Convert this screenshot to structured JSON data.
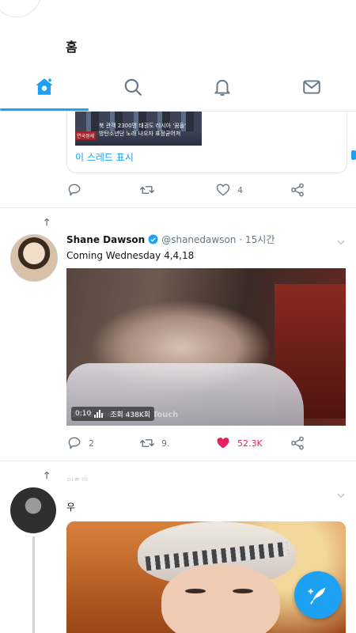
{
  "header": {
    "title": "홈"
  },
  "tabs": [
    "home",
    "search",
    "notifications",
    "messages"
  ],
  "quoted": {
    "thumb_caption_1": "북 관객 2300명 태권도 러시아 '꿈돌'",
    "thumb_caption_2": "방탄소년단 노래 나오자 표정굳어져",
    "thumb_channel": "연국정세",
    "show_thread": "이 스레드 표시"
  },
  "tweet0_actions": {
    "reply": "",
    "retweet": "",
    "like": "4"
  },
  "tweet1": {
    "name": "Shane Dawson",
    "handle": "@shanedawson",
    "time": "· 15시간",
    "text": "Coming Wednesday 4,4,18",
    "video": {
      "duration": "0:10",
      "views": "조회 438K회",
      "watermark": "1975 The Medusa Touch"
    },
    "actions": {
      "reply": "2",
      "retweet": "9.",
      "like": "52.3K"
    }
  },
  "tweet2": {
    "blurred_text": "리트윗 ...",
    "glyph": "우"
  },
  "colors": {
    "accent": "#1da1f2",
    "like": "#e0245e",
    "muted": "#657786",
    "border": "#e1e8ed"
  },
  "icons": {
    "reply": "reply-icon",
    "retweet": "retweet-icon",
    "like": "heart-icon",
    "share": "share-icon",
    "fab": "compose-icon",
    "verified": "verified-badge-icon"
  }
}
